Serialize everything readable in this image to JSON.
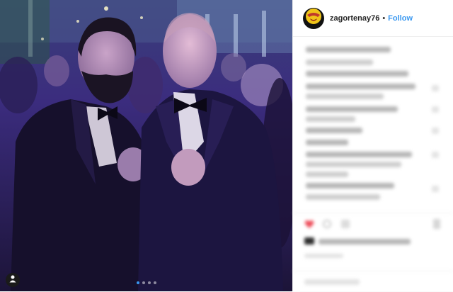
{
  "post": {
    "username": "zagortenay76",
    "separator": "•",
    "follow_label": "Follow",
    "carousel_count": 4,
    "carousel_active_index": 1
  },
  "icons": {
    "avatar": "zagor-avatar-icon",
    "profile": "person-icon",
    "like": "heart-icon",
    "comment": "comment-icon",
    "share": "share-icon",
    "save": "bookmark-icon"
  },
  "colors": {
    "accent": "#3897f0",
    "username": "#262626",
    "photo_tint": "#3c2a8c"
  }
}
